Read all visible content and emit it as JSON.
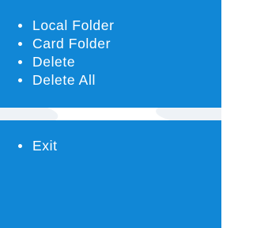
{
  "menu": {
    "items": [
      {
        "label": "Local Folder"
      },
      {
        "label": "Card Folder"
      },
      {
        "label": "Delete"
      },
      {
        "label": "Delete All"
      }
    ]
  },
  "exit_menu": {
    "items": [
      {
        "label": "Exit"
      }
    ]
  },
  "colors": {
    "panel_background": "#1187d6",
    "text": "#ffffff",
    "separator": "#ffffff"
  }
}
